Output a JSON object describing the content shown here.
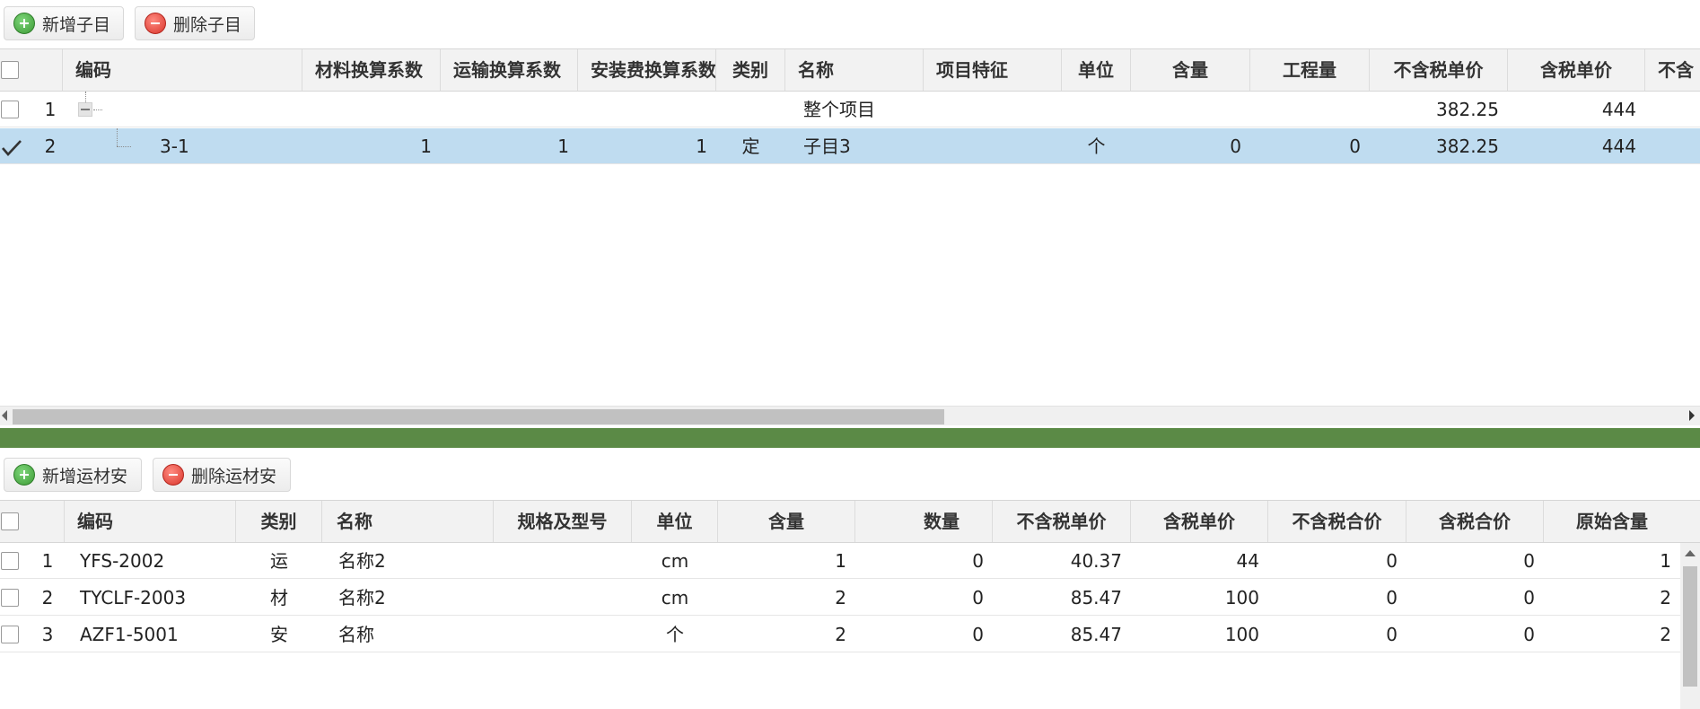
{
  "top_toolbar": {
    "add_label": "新增子目",
    "delete_label": "删除子目"
  },
  "top_grid": {
    "columns": [
      "编码",
      "材料换算系数",
      "运输换算系数",
      "安装费换算系数",
      "类别",
      "名称",
      "项目特征",
      "单位",
      "含量",
      "工程量",
      "不含税单价",
      "含税单价",
      "不含"
    ],
    "rows": [
      {
        "num": "1",
        "code": "",
        "mat_coef": "",
        "trans_coef": "",
        "install_coef": "",
        "type": "",
        "name": "整个项目",
        "feature": "",
        "unit": "",
        "qty": "",
        "eng_qty": "",
        "price_ex_tax": "382.25",
        "price_inc_tax": "444",
        "checked": false,
        "selected": false
      },
      {
        "num": "2",
        "code": "3-1",
        "mat_coef": "1",
        "trans_coef": "1",
        "install_coef": "1",
        "type": "定",
        "name": "子目3",
        "feature": "",
        "unit": "个",
        "qty": "0",
        "eng_qty": "0",
        "price_ex_tax": "382.25",
        "price_inc_tax": "444",
        "checked": true,
        "selected": true
      }
    ]
  },
  "bottom_toolbar": {
    "add_label": "新增运材安",
    "delete_label": "删除运材安"
  },
  "bottom_grid": {
    "columns": [
      "编码",
      "类别",
      "名称",
      "规格及型号",
      "单位",
      "含量",
      "数量",
      "不含税单价",
      "含税单价",
      "不含税合价",
      "含税合价",
      "原始含量"
    ],
    "rows": [
      {
        "num": "1",
        "code": "YFS-2002",
        "type": "运",
        "name": "名称2",
        "spec": "",
        "unit": "cm",
        "qty": "1",
        "count": "0",
        "price_ex_tax": "40.37",
        "price_inc_tax": "44",
        "total_ex_tax": "0",
        "total_inc_tax": "0",
        "orig_qty": "1"
      },
      {
        "num": "2",
        "code": "TYCLF-2003",
        "type": "材",
        "name": "名称2",
        "spec": "",
        "unit": "cm",
        "qty": "2",
        "count": "0",
        "price_ex_tax": "85.47",
        "price_inc_tax": "100",
        "total_ex_tax": "0",
        "total_inc_tax": "0",
        "orig_qty": "2"
      },
      {
        "num": "3",
        "code": "AZF1-5001",
        "type": "安",
        "name": "名称",
        "spec": "",
        "unit": "个",
        "qty": "2",
        "count": "0",
        "price_ex_tax": "85.47",
        "price_inc_tax": "100",
        "total_ex_tax": "0",
        "total_inc_tax": "0",
        "orig_qty": "2"
      }
    ]
  },
  "colors": {
    "selected_row": "#bfdcf0",
    "splitter": "#5b8a46",
    "header_bg": "#f2f2f2"
  }
}
